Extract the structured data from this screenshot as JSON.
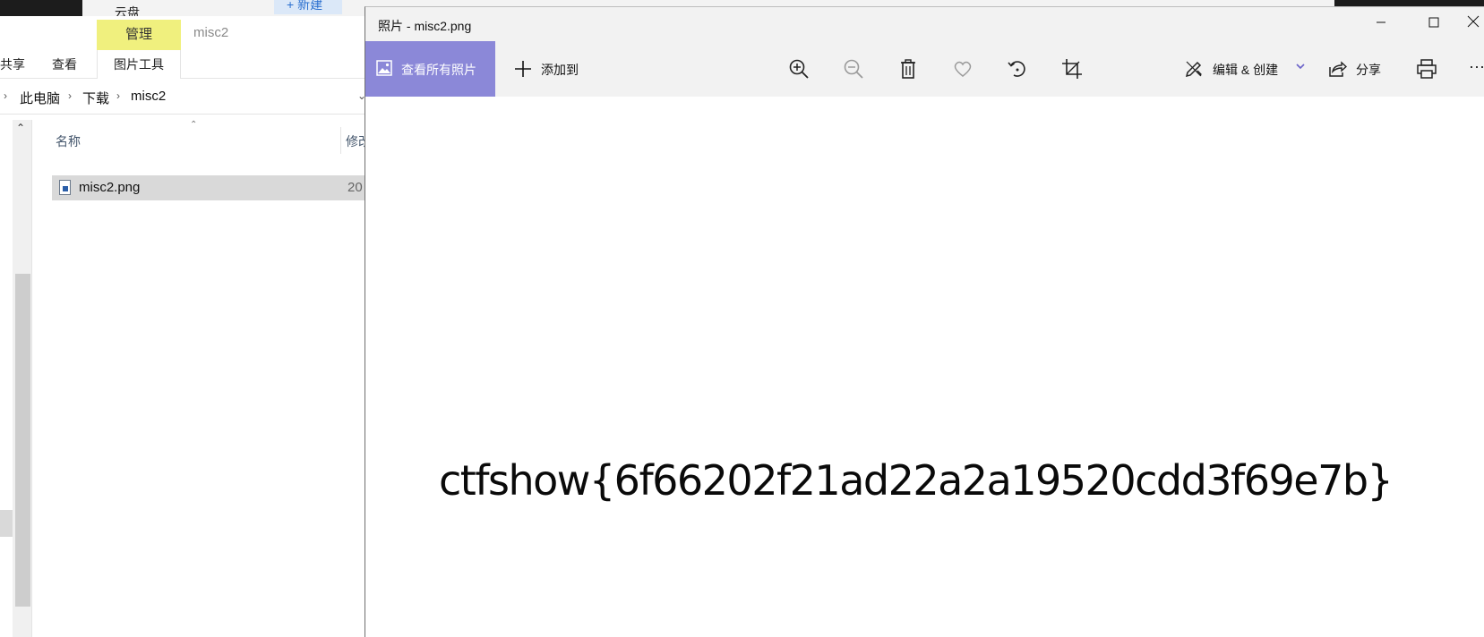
{
  "background": {
    "cloud_label": "云盘",
    "new_button": "+ 新建"
  },
  "explorer": {
    "ribbon": {
      "manage_tab": "管理",
      "window_name": "misc2",
      "share_tab": "共享",
      "view_tab": "查看",
      "image_tools_tab": "图片工具"
    },
    "breadcrumb": [
      "此电脑",
      "下载",
      "misc2"
    ],
    "columns": {
      "name": "名称",
      "modified": "修改日期"
    },
    "files": [
      {
        "name": "misc2.png",
        "date": "20",
        "icon": "png-file-icon"
      }
    ]
  },
  "photos": {
    "title": "照片 - misc2.png",
    "window_controls": {
      "minimize": "—",
      "maximize": "☐",
      "close": "✕"
    },
    "toolbar": {
      "view_all_label": "查看所有照片",
      "add_to_label": "添加到",
      "edit_create_label": "编辑 & 创建",
      "share_label": "分享",
      "more_label": "···",
      "icons": [
        "zoom-in-icon",
        "zoom-out-icon",
        "delete-icon",
        "favorite-icon",
        "rotate-icon",
        "crop-icon",
        "print-icon"
      ]
    },
    "image_text": "ctfshow{6f66202f21ad22a2a19520cdd3f69e7b}"
  },
  "colors": {
    "accent": "#8b88d8",
    "manage_tab": "#f0f07e",
    "selection": "#d9d9d9",
    "toolbar_bg": "#f2f2f2",
    "chevron": "#6b63c9"
  }
}
